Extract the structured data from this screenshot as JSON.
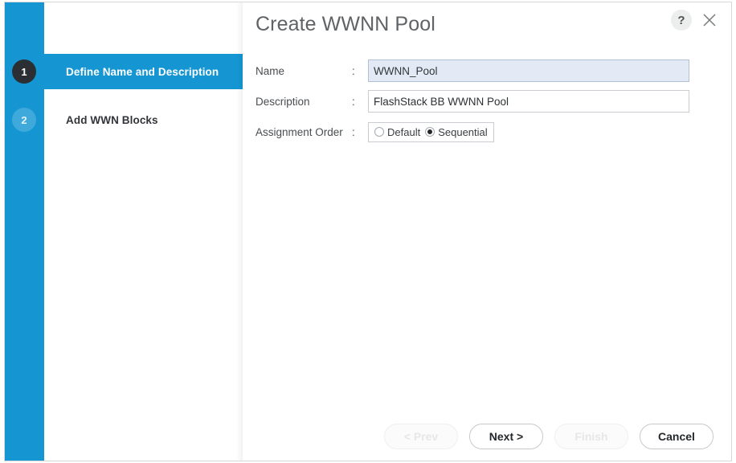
{
  "dialog": {
    "title": "Create WWNN Pool",
    "help_icon": "question-mark-icon",
    "close_icon": "close-icon"
  },
  "wizard": {
    "steps": [
      {
        "number": "1",
        "label": "Define Name and Description",
        "active": true
      },
      {
        "number": "2",
        "label": "Add WWN Blocks",
        "active": false
      }
    ]
  },
  "form": {
    "name": {
      "label": "Name",
      "separator": ":",
      "value": "WWNN_Pool",
      "placeholder": ""
    },
    "description": {
      "label": "Description",
      "separator": ":",
      "value": "FlashStack BB WWNN Pool",
      "placeholder": ""
    },
    "assignment_order": {
      "label": "Assignment Order",
      "separator": ":",
      "options": [
        {
          "label": "Default",
          "selected": false
        },
        {
          "label": "Sequential",
          "selected": true
        }
      ],
      "selected": "Sequential"
    }
  },
  "footer": {
    "prev_label": "< Prev",
    "next_label": "Next >",
    "finish_label": "Finish",
    "cancel_label": "Cancel"
  },
  "colors": {
    "accent_blue": "#1596d3",
    "step_current": "#2b2f33",
    "step_upcoming": "#3ea9da",
    "focused_input": "#e3eaf6"
  }
}
